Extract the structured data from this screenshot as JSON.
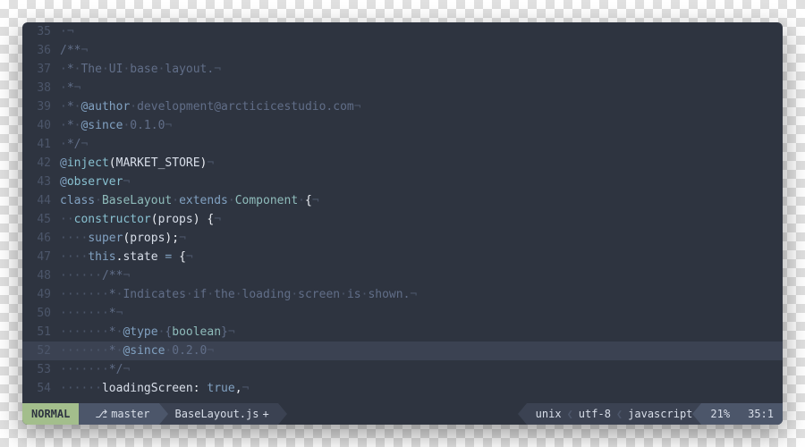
{
  "lines": [
    {
      "n": 35,
      "hl": false,
      "tokens": [
        {
          "t": "·",
          "c": "invis"
        },
        {
          "t": "¬",
          "c": "invis"
        }
      ]
    },
    {
      "n": 36,
      "hl": false,
      "tokens": [
        {
          "t": "/**",
          "c": "c-comment"
        },
        {
          "t": "¬",
          "c": "invis"
        }
      ]
    },
    {
      "n": 37,
      "hl": false,
      "tokens": [
        {
          "t": "·",
          "c": "invis"
        },
        {
          "t": "*",
          "c": "c-comment"
        },
        {
          "t": "·",
          "c": "invis"
        },
        {
          "t": "The",
          "c": "c-comment"
        },
        {
          "t": "·",
          "c": "invis"
        },
        {
          "t": "UI",
          "c": "c-comment"
        },
        {
          "t": "·",
          "c": "invis"
        },
        {
          "t": "base",
          "c": "c-comment"
        },
        {
          "t": "·",
          "c": "invis"
        },
        {
          "t": "layout.",
          "c": "c-comment"
        },
        {
          "t": "¬",
          "c": "invis"
        }
      ]
    },
    {
      "n": 38,
      "hl": false,
      "tokens": [
        {
          "t": "·",
          "c": "invis"
        },
        {
          "t": "*",
          "c": "c-comment"
        },
        {
          "t": "¬",
          "c": "invis"
        }
      ]
    },
    {
      "n": 39,
      "hl": false,
      "tokens": [
        {
          "t": "·",
          "c": "invis"
        },
        {
          "t": "*",
          "c": "c-comment"
        },
        {
          "t": "·",
          "c": "invis"
        },
        {
          "t": "@author",
          "c": "c-tag"
        },
        {
          "t": "·",
          "c": "invis"
        },
        {
          "t": "development@arcticicestudio.com",
          "c": "c-comment"
        },
        {
          "t": "¬",
          "c": "invis"
        }
      ]
    },
    {
      "n": 40,
      "hl": false,
      "tokens": [
        {
          "t": "·",
          "c": "invis"
        },
        {
          "t": "*",
          "c": "c-comment"
        },
        {
          "t": "·",
          "c": "invis"
        },
        {
          "t": "@since",
          "c": "c-tag"
        },
        {
          "t": "·",
          "c": "invis"
        },
        {
          "t": "0.1.0",
          "c": "c-comment"
        },
        {
          "t": "¬",
          "c": "invis"
        }
      ]
    },
    {
      "n": 41,
      "hl": false,
      "tokens": [
        {
          "t": "·",
          "c": "invis"
        },
        {
          "t": "*/",
          "c": "c-comment"
        },
        {
          "t": "¬",
          "c": "invis"
        }
      ]
    },
    {
      "n": 42,
      "hl": false,
      "tokens": [
        {
          "t": "@",
          "c": "c-kw"
        },
        {
          "t": "inject",
          "c": "c-fn"
        },
        {
          "t": "(",
          "c": "c-pn"
        },
        {
          "t": "MARKET_STORE",
          "c": ""
        },
        {
          "t": ")",
          "c": "c-pn"
        },
        {
          "t": "¬",
          "c": "invis"
        }
      ]
    },
    {
      "n": 43,
      "hl": false,
      "tokens": [
        {
          "t": "@",
          "c": "c-kw"
        },
        {
          "t": "observer",
          "c": "c-fn"
        },
        {
          "t": "¬",
          "c": "invis"
        }
      ]
    },
    {
      "n": 44,
      "hl": false,
      "tokens": [
        {
          "t": "class",
          "c": "c-kw"
        },
        {
          "t": "·",
          "c": "invis"
        },
        {
          "t": "BaseLayout",
          "c": "c-cls"
        },
        {
          "t": "·",
          "c": "invis"
        },
        {
          "t": "extends",
          "c": "c-kw"
        },
        {
          "t": "·",
          "c": "invis"
        },
        {
          "t": "Component",
          "c": "c-cls"
        },
        {
          "t": "·",
          "c": "invis"
        },
        {
          "t": "{",
          "c": "c-pn"
        },
        {
          "t": "¬",
          "c": "invis"
        }
      ]
    },
    {
      "n": 45,
      "hl": false,
      "tokens": [
        {
          "t": "··",
          "c": "invis"
        },
        {
          "t": "constructor",
          "c": "c-fn"
        },
        {
          "t": "(",
          "c": "c-pn"
        },
        {
          "t": "props",
          "c": ""
        },
        {
          "t": ")",
          "c": "c-pn"
        },
        {
          "t": " ",
          "c": ""
        },
        {
          "t": "{",
          "c": "c-pn"
        },
        {
          "t": "¬",
          "c": "invis"
        }
      ]
    },
    {
      "n": 46,
      "hl": false,
      "tokens": [
        {
          "t": "····",
          "c": "invis"
        },
        {
          "t": "super",
          "c": "c-kw"
        },
        {
          "t": "(",
          "c": "c-pn"
        },
        {
          "t": "props",
          "c": ""
        },
        {
          "t": ");",
          "c": "c-pn"
        },
        {
          "t": "¬",
          "c": "invis"
        }
      ]
    },
    {
      "n": 47,
      "hl": false,
      "tokens": [
        {
          "t": "····",
          "c": "invis"
        },
        {
          "t": "this",
          "c": "c-kw"
        },
        {
          "t": ".",
          "c": "c-pn"
        },
        {
          "t": "state",
          "c": ""
        },
        {
          "t": " ",
          "c": ""
        },
        {
          "t": "=",
          "c": "c-kw"
        },
        {
          "t": " ",
          "c": ""
        },
        {
          "t": "{",
          "c": "c-pn"
        },
        {
          "t": "¬",
          "c": "invis"
        }
      ]
    },
    {
      "n": 48,
      "hl": false,
      "tokens": [
        {
          "t": "······",
          "c": "invis"
        },
        {
          "t": "/**",
          "c": "c-comment"
        },
        {
          "t": "¬",
          "c": "invis"
        }
      ]
    },
    {
      "n": 49,
      "hl": false,
      "tokens": [
        {
          "t": "·······",
          "c": "invis"
        },
        {
          "t": "*",
          "c": "c-comment"
        },
        {
          "t": "·",
          "c": "invis"
        },
        {
          "t": "Indicates",
          "c": "c-comment"
        },
        {
          "t": "·",
          "c": "invis"
        },
        {
          "t": "if",
          "c": "c-comment"
        },
        {
          "t": "·",
          "c": "invis"
        },
        {
          "t": "the",
          "c": "c-comment"
        },
        {
          "t": "·",
          "c": "invis"
        },
        {
          "t": "loading",
          "c": "c-comment"
        },
        {
          "t": "·",
          "c": "invis"
        },
        {
          "t": "screen",
          "c": "c-comment"
        },
        {
          "t": "·",
          "c": "invis"
        },
        {
          "t": "is",
          "c": "c-comment"
        },
        {
          "t": "·",
          "c": "invis"
        },
        {
          "t": "shown.",
          "c": "c-comment"
        },
        {
          "t": "¬",
          "c": "invis"
        }
      ]
    },
    {
      "n": 50,
      "hl": false,
      "tokens": [
        {
          "t": "·······",
          "c": "invis"
        },
        {
          "t": "*",
          "c": "c-comment"
        },
        {
          "t": "¬",
          "c": "invis"
        }
      ]
    },
    {
      "n": 51,
      "hl": false,
      "tokens": [
        {
          "t": "·······",
          "c": "invis"
        },
        {
          "t": "*",
          "c": "c-comment"
        },
        {
          "t": "·",
          "c": "invis"
        },
        {
          "t": "@type",
          "c": "c-tag"
        },
        {
          "t": "·",
          "c": "invis"
        },
        {
          "t": "{",
          "c": "c-comment"
        },
        {
          "t": "boolean",
          "c": "c-type"
        },
        {
          "t": "}",
          "c": "c-comment"
        },
        {
          "t": "¬",
          "c": "invis"
        }
      ]
    },
    {
      "n": 52,
      "hl": true,
      "tokens": [
        {
          "t": "·······",
          "c": "invis"
        },
        {
          "t": "*",
          "c": "c-comment"
        },
        {
          "t": "·",
          "c": "invis"
        },
        {
          "t": "@since",
          "c": "c-tag"
        },
        {
          "t": "·",
          "c": "invis"
        },
        {
          "t": "0.2.0",
          "c": "c-comment"
        },
        {
          "t": "¬",
          "c": "invis"
        }
      ]
    },
    {
      "n": 53,
      "hl": false,
      "tokens": [
        {
          "t": "·······",
          "c": "invis"
        },
        {
          "t": "*/",
          "c": "c-comment"
        },
        {
          "t": "¬",
          "c": "invis"
        }
      ]
    },
    {
      "n": 54,
      "hl": false,
      "tokens": [
        {
          "t": "······",
          "c": "invis"
        },
        {
          "t": "loadingScreen",
          "c": ""
        },
        {
          "t": ":",
          "c": "c-pn"
        },
        {
          "t": " ",
          "c": ""
        },
        {
          "t": "true",
          "c": "c-bool"
        },
        {
          "t": ",",
          "c": "c-pn"
        },
        {
          "t": "¬",
          "c": "invis"
        }
      ]
    }
  ],
  "status": {
    "mode": "NORMAL",
    "branch_icon": "⎇",
    "branch": "master",
    "filename": "BaseLayout.js",
    "modified": "+",
    "fileformat": "unix",
    "encoding": "utf-8",
    "filetype": "javascript",
    "percent": "21%",
    "position": "35:1"
  }
}
